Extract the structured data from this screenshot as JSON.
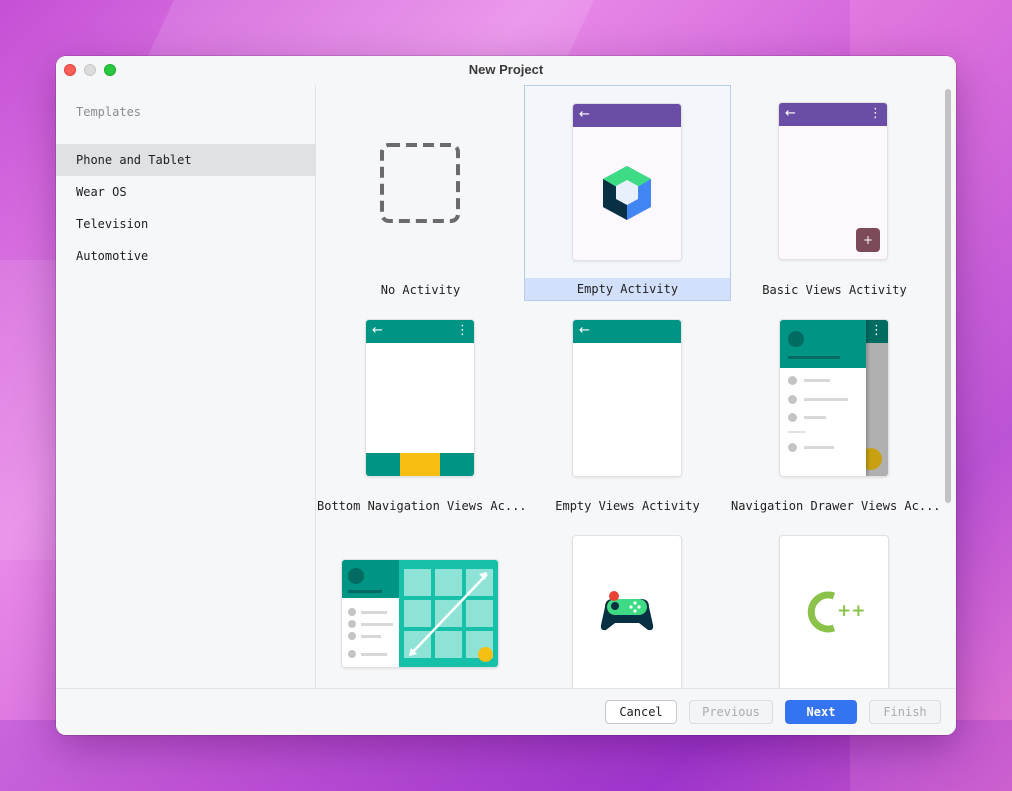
{
  "window": {
    "title": "New Project"
  },
  "sidebar": {
    "header": "Templates",
    "items": [
      {
        "label": "Phone and Tablet",
        "selected": true
      },
      {
        "label": "Wear OS",
        "selected": false
      },
      {
        "label": "Television",
        "selected": false
      },
      {
        "label": "Automotive",
        "selected": false
      }
    ]
  },
  "templates": [
    {
      "label": "No Activity",
      "selected": false,
      "icon": "dashed-box-icon"
    },
    {
      "label": "Empty Activity",
      "selected": true,
      "icon": "compose-icon"
    },
    {
      "label": "Basic Views Activity",
      "selected": false,
      "icon": "basic-views-icon"
    },
    {
      "label": "Bottom Navigation Views Ac...",
      "selected": false,
      "icon": "bottom-nav-icon"
    },
    {
      "label": "Empty Views Activity",
      "selected": false,
      "icon": "empty-views-icon"
    },
    {
      "label": "Navigation Drawer Views Ac...",
      "selected": false,
      "icon": "nav-drawer-icon"
    },
    {
      "label": "",
      "selected": false,
      "icon": "responsive-views-icon"
    },
    {
      "label": "",
      "selected": false,
      "icon": "game-controller-icon"
    },
    {
      "label": "",
      "selected": false,
      "icon": "cpp-icon"
    }
  ],
  "footer": {
    "cancel": "Cancel",
    "previous": "Previous",
    "next": "Next",
    "finish": "Finish"
  },
  "colors": {
    "purple_appbar": "#6a4ea5",
    "teal_appbar": "#009485",
    "accent_blue": "#3574f0",
    "selection": "#d3e0fb",
    "yellow": "#f8bf13",
    "fab_maroon": "#7d4a5a"
  }
}
